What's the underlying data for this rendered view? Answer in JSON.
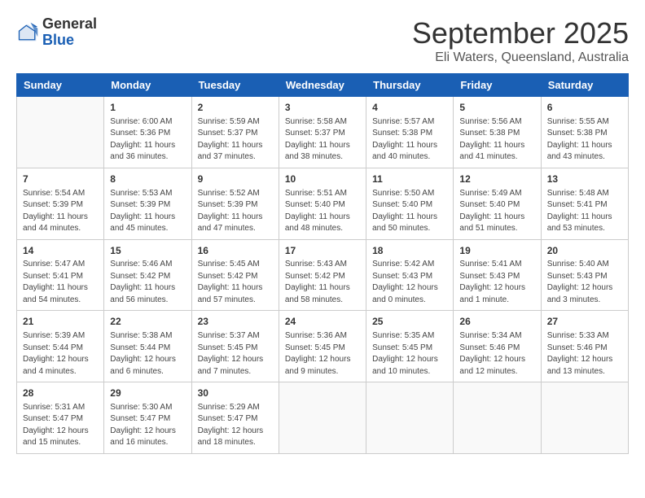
{
  "header": {
    "logo_line1": "General",
    "logo_line2": "Blue",
    "title": "September 2025",
    "subtitle": "Eli Waters, Queensland, Australia"
  },
  "days_of_week": [
    "Sunday",
    "Monday",
    "Tuesday",
    "Wednesday",
    "Thursday",
    "Friday",
    "Saturday"
  ],
  "weeks": [
    [
      {
        "day": "",
        "info": ""
      },
      {
        "day": "1",
        "info": "Sunrise: 6:00 AM\nSunset: 5:36 PM\nDaylight: 11 hours\nand 36 minutes."
      },
      {
        "day": "2",
        "info": "Sunrise: 5:59 AM\nSunset: 5:37 PM\nDaylight: 11 hours\nand 37 minutes."
      },
      {
        "day": "3",
        "info": "Sunrise: 5:58 AM\nSunset: 5:37 PM\nDaylight: 11 hours\nand 38 minutes."
      },
      {
        "day": "4",
        "info": "Sunrise: 5:57 AM\nSunset: 5:38 PM\nDaylight: 11 hours\nand 40 minutes."
      },
      {
        "day": "5",
        "info": "Sunrise: 5:56 AM\nSunset: 5:38 PM\nDaylight: 11 hours\nand 41 minutes."
      },
      {
        "day": "6",
        "info": "Sunrise: 5:55 AM\nSunset: 5:38 PM\nDaylight: 11 hours\nand 43 minutes."
      }
    ],
    [
      {
        "day": "7",
        "info": "Sunrise: 5:54 AM\nSunset: 5:39 PM\nDaylight: 11 hours\nand 44 minutes."
      },
      {
        "day": "8",
        "info": "Sunrise: 5:53 AM\nSunset: 5:39 PM\nDaylight: 11 hours\nand 45 minutes."
      },
      {
        "day": "9",
        "info": "Sunrise: 5:52 AM\nSunset: 5:39 PM\nDaylight: 11 hours\nand 47 minutes."
      },
      {
        "day": "10",
        "info": "Sunrise: 5:51 AM\nSunset: 5:40 PM\nDaylight: 11 hours\nand 48 minutes."
      },
      {
        "day": "11",
        "info": "Sunrise: 5:50 AM\nSunset: 5:40 PM\nDaylight: 11 hours\nand 50 minutes."
      },
      {
        "day": "12",
        "info": "Sunrise: 5:49 AM\nSunset: 5:40 PM\nDaylight: 11 hours\nand 51 minutes."
      },
      {
        "day": "13",
        "info": "Sunrise: 5:48 AM\nSunset: 5:41 PM\nDaylight: 11 hours\nand 53 minutes."
      }
    ],
    [
      {
        "day": "14",
        "info": "Sunrise: 5:47 AM\nSunset: 5:41 PM\nDaylight: 11 hours\nand 54 minutes."
      },
      {
        "day": "15",
        "info": "Sunrise: 5:46 AM\nSunset: 5:42 PM\nDaylight: 11 hours\nand 56 minutes."
      },
      {
        "day": "16",
        "info": "Sunrise: 5:45 AM\nSunset: 5:42 PM\nDaylight: 11 hours\nand 57 minutes."
      },
      {
        "day": "17",
        "info": "Sunrise: 5:43 AM\nSunset: 5:42 PM\nDaylight: 11 hours\nand 58 minutes."
      },
      {
        "day": "18",
        "info": "Sunrise: 5:42 AM\nSunset: 5:43 PM\nDaylight: 12 hours\nand 0 minutes."
      },
      {
        "day": "19",
        "info": "Sunrise: 5:41 AM\nSunset: 5:43 PM\nDaylight: 12 hours\nand 1 minute."
      },
      {
        "day": "20",
        "info": "Sunrise: 5:40 AM\nSunset: 5:43 PM\nDaylight: 12 hours\nand 3 minutes."
      }
    ],
    [
      {
        "day": "21",
        "info": "Sunrise: 5:39 AM\nSunset: 5:44 PM\nDaylight: 12 hours\nand 4 minutes."
      },
      {
        "day": "22",
        "info": "Sunrise: 5:38 AM\nSunset: 5:44 PM\nDaylight: 12 hours\nand 6 minutes."
      },
      {
        "day": "23",
        "info": "Sunrise: 5:37 AM\nSunset: 5:45 PM\nDaylight: 12 hours\nand 7 minutes."
      },
      {
        "day": "24",
        "info": "Sunrise: 5:36 AM\nSunset: 5:45 PM\nDaylight: 12 hours\nand 9 minutes."
      },
      {
        "day": "25",
        "info": "Sunrise: 5:35 AM\nSunset: 5:45 PM\nDaylight: 12 hours\nand 10 minutes."
      },
      {
        "day": "26",
        "info": "Sunrise: 5:34 AM\nSunset: 5:46 PM\nDaylight: 12 hours\nand 12 minutes."
      },
      {
        "day": "27",
        "info": "Sunrise: 5:33 AM\nSunset: 5:46 PM\nDaylight: 12 hours\nand 13 minutes."
      }
    ],
    [
      {
        "day": "28",
        "info": "Sunrise: 5:31 AM\nSunset: 5:47 PM\nDaylight: 12 hours\nand 15 minutes."
      },
      {
        "day": "29",
        "info": "Sunrise: 5:30 AM\nSunset: 5:47 PM\nDaylight: 12 hours\nand 16 minutes."
      },
      {
        "day": "30",
        "info": "Sunrise: 5:29 AM\nSunset: 5:47 PM\nDaylight: 12 hours\nand 18 minutes."
      },
      {
        "day": "",
        "info": ""
      },
      {
        "day": "",
        "info": ""
      },
      {
        "day": "",
        "info": ""
      },
      {
        "day": "",
        "info": ""
      }
    ]
  ]
}
